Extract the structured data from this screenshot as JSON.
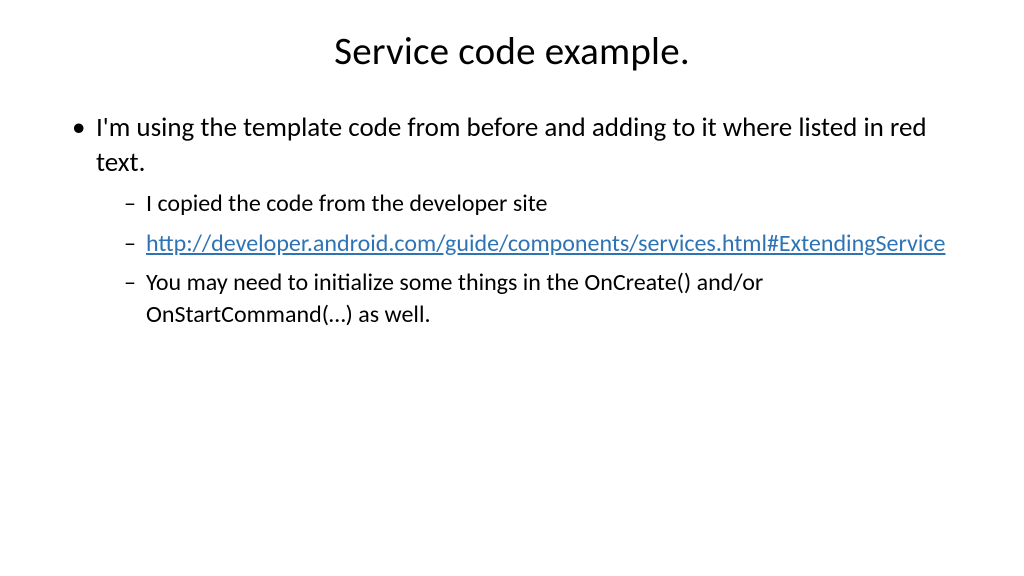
{
  "slide": {
    "title": "Service code example.",
    "bullets": [
      {
        "text": "I'm using the template code from before and adding to it where listed in red text.",
        "sub": [
          {
            "text": "I copied the code from the developer site"
          },
          {
            "link": "http://developer.android.com/guide/components/services.html#ExtendingService"
          },
          {
            "text": "You may need to initialize some things in the OnCreate() and/or OnStartCommand(…) as well."
          }
        ]
      }
    ]
  }
}
